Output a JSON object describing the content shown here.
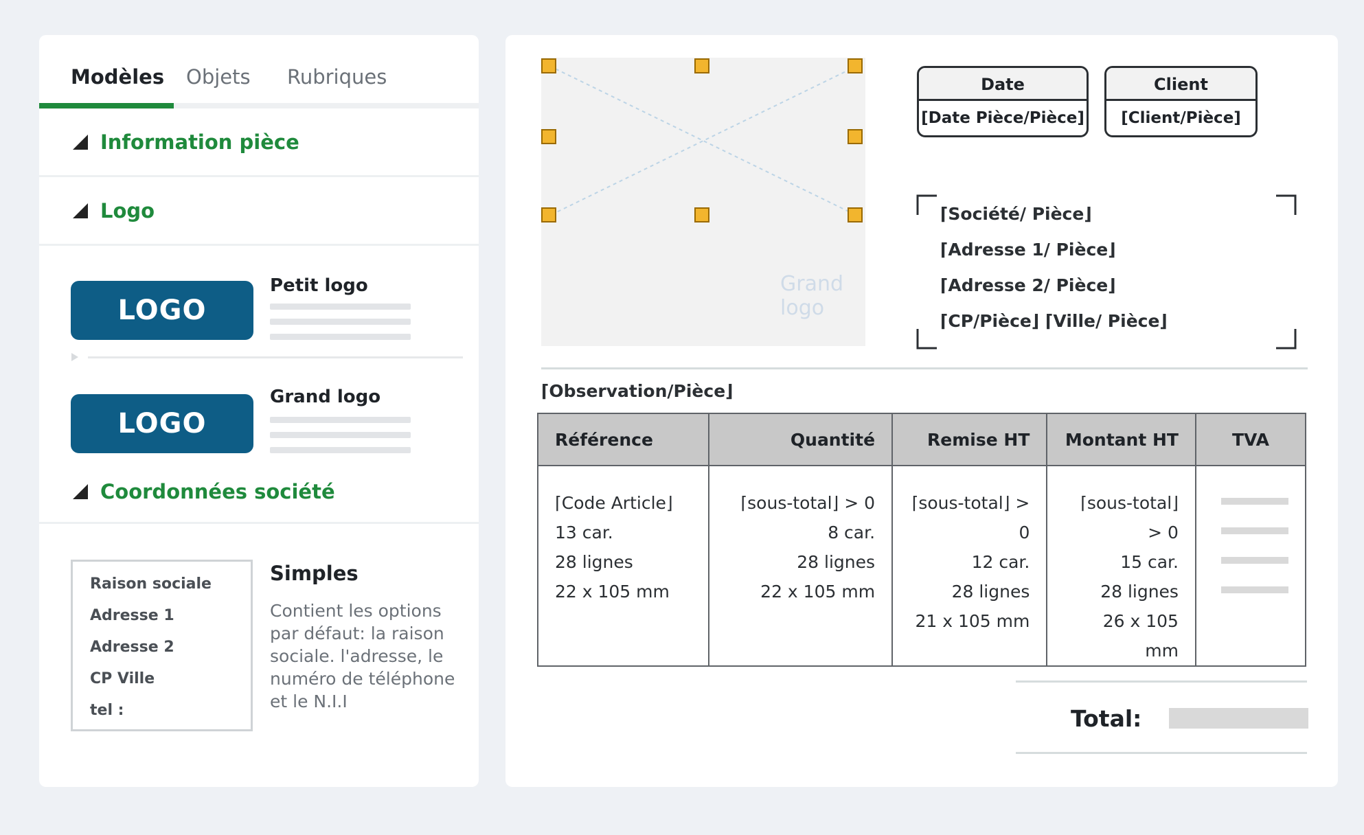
{
  "tabs": [
    {
      "label": "Modèles",
      "active": true
    },
    {
      "label": "Objets",
      "active": false
    },
    {
      "label": "Rubriques",
      "active": false
    }
  ],
  "sections": {
    "info": "Information pièce",
    "logo": "Logo",
    "coord": "Coordonnées société"
  },
  "logo_options": {
    "logo_text": "LOGO",
    "small": "Petit logo",
    "large": "Grand logo"
  },
  "company": {
    "fields": [
      "Raison sociale",
      "Adresse 1",
      "Adresse 2",
      "CP Ville",
      "tel :"
    ],
    "title": "Simples",
    "description": "Contient les options par défaut: la raison sociale. l'adresse, le numéro de téléphone et le N.I.I"
  },
  "document": {
    "logo_placeholder": "Grand logo",
    "date_box": {
      "label": "Date",
      "value": "[Date Pièce/Pièce]"
    },
    "client_box": {
      "label": "Client",
      "value": "[Client/Pièce]"
    },
    "address_lines": [
      "⌈Société/ Pièce⌋",
      "⌈Adresse 1/ Pièce⌋",
      "⌈Adresse 2/ Pièce⌋",
      "⌈CP/Pièce⌋  ⌈Ville/ Pièce⌋"
    ],
    "observation": "⌈Observation/Pièce⌋",
    "table": {
      "headers": [
        "Référence",
        "Quantité",
        "Remise HT",
        "Montant HT",
        "TVA"
      ],
      "columns": [
        [
          "⌈Code Article⌋",
          "13 car.",
          "28 lignes",
          "22 x 105 mm"
        ],
        [
          "⌈sous-total⌋ > 0",
          "8 car.",
          "28 lignes",
          "22 x 105 mm"
        ],
        [
          "⌈sous-total⌋ > 0",
          "12 car.",
          "28 lignes",
          "21 x 105 mm"
        ],
        [
          "⌈sous-total⌋ > 0",
          "15 car.",
          "28 lignes",
          "26 x 105 mm"
        ]
      ]
    },
    "total_label": "Total:"
  },
  "colors": {
    "accent_green": "#1f8a3c",
    "logo_blue": "#0e5d86",
    "handle_orange": "#f2b52e"
  }
}
